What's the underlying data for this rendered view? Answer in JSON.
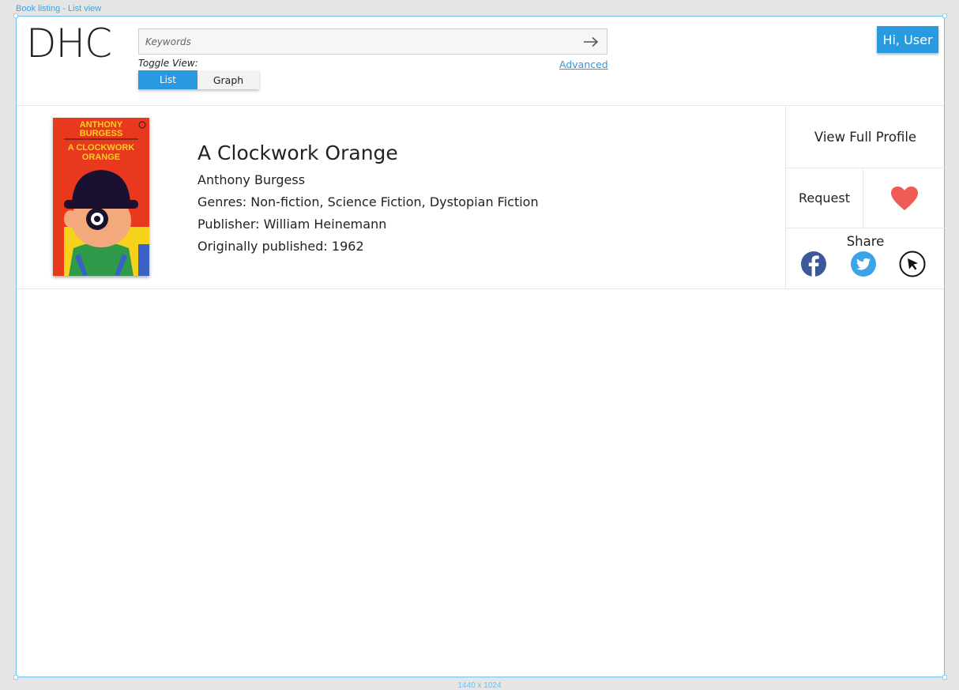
{
  "frame": {
    "label": "Book listing - List view",
    "size_label": "1440 x 1024"
  },
  "header": {
    "logo": "DHC",
    "search": {
      "placeholder": "Keywords",
      "value": ""
    },
    "toggle_label": "Toggle View:",
    "toggle_options": [
      "List",
      "Graph"
    ],
    "active_toggle": "List",
    "advanced_link": "Advanced",
    "user_button": "Hi, User"
  },
  "book": {
    "cover_text": {
      "author": "ANTHONY BURGESS",
      "title": "A CLOCKWORK ORANGE"
    },
    "title": "A Clockwork Orange",
    "author": "Anthony Burgess",
    "genres": "Genres: Non-fiction, Science Fiction, Dystopian Fiction",
    "publisher": "Publisher: William Heinemann",
    "published": "Originally published: 1962"
  },
  "actions": {
    "view_profile": "View Full Profile",
    "request": "Request",
    "favorite_icon": "heart-icon",
    "share_label": "Share",
    "share_icons": [
      "facebook-icon",
      "twitter-icon",
      "pointer-icon"
    ]
  },
  "colors": {
    "accent": "#2a9ae0",
    "heart": "#ef5b55",
    "facebook": "#3b5998",
    "twitter": "#3ba3e6"
  }
}
